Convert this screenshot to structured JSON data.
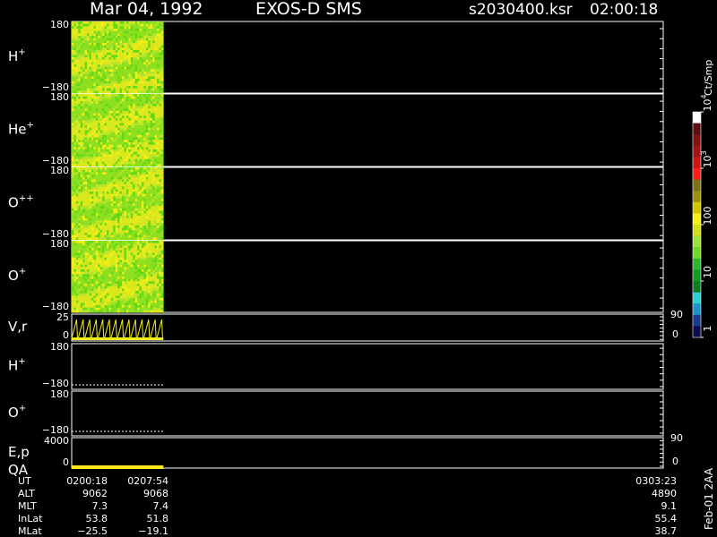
{
  "header": {
    "date": "Mar 04, 1992",
    "instrument": "EXOS-D SMS",
    "file_name": "s2030400.ksr",
    "time": "02:00:18"
  },
  "chart_data": {
    "type": "heatmap",
    "colorbar": {
      "label": "Ct/Smp",
      "ticks": [
        "1",
        "10",
        "100",
        "10",
        "10"
      ],
      "tick_exponents": [
        "",
        "",
        "",
        "3",
        "4"
      ],
      "min": 1,
      "max": 10000,
      "scale": "log",
      "colors": [
        "#0b0b52",
        "#163a8c",
        "#1f93c8",
        "#2bd0cf",
        "#0d7d24",
        "#129d22",
        "#2eb62d",
        "#71d92b",
        "#9be33a",
        "#d3dd16",
        "#f2ef17",
        "#d1c500",
        "#9c900f",
        "#7b7115",
        "#ff1d18",
        "#ce1515",
        "#a31414",
        "#821111",
        "#5d0f0f",
        "#ffffff"
      ]
    },
    "panels": [
      {
        "id": "h_plus_pitch",
        "label": "H",
        "label_superscript": "+",
        "kind": "spectrogram",
        "ylim": [
          -180,
          180
        ],
        "y_ticks": [
          "180",
          "−180"
        ],
        "data_fill": 0.155
      },
      {
        "id": "he_plus_pitch",
        "label": "He",
        "label_superscript": "+",
        "kind": "spectrogram",
        "ylim": [
          -180,
          180
        ],
        "y_ticks": [
          "180",
          "−180"
        ],
        "data_fill": 0.155
      },
      {
        "id": "o_plus_plus_pitch",
        "label": "O",
        "label_superscript": "++",
        "kind": "spectrogram",
        "ylim": [
          -180,
          180
        ],
        "y_ticks": [
          "180",
          "−180"
        ],
        "data_fill": 0.155
      },
      {
        "id": "o_plus_pitch",
        "label": "O",
        "label_superscript": "+",
        "kind": "spectrogram",
        "ylim": [
          -180,
          180
        ],
        "y_ticks": [
          "180",
          "−180"
        ],
        "data_fill": 0.155
      },
      {
        "id": "velocity_r",
        "label": "V,r",
        "label_superscript": "",
        "kind": "line",
        "left_ylim": [
          0,
          25
        ],
        "right_ylim": [
          0,
          90
        ],
        "y_ticks": [
          "25",
          "0"
        ],
        "right_ticks": [
          "90",
          "0"
        ],
        "data_fill": 0.155
      },
      {
        "id": "h_plus_line",
        "label": "H",
        "label_superscript": "+",
        "kind": "trace",
        "ylim": [
          -180,
          180
        ],
        "y_ticks": [
          "180",
          "−180"
        ],
        "data_fill": 0.155
      },
      {
        "id": "o_plus_line",
        "label": "O",
        "label_superscript": "+",
        "kind": "trace",
        "ylim": [
          -180,
          180
        ],
        "y_ticks": [
          "180",
          "−180"
        ],
        "data_fill": 0.155
      },
      {
        "id": "ep_qa",
        "label": "E,p",
        "label2": "QA",
        "label_superscript": "",
        "kind": "qa",
        "left_ylim": [
          0,
          4000
        ],
        "right_ylim": [
          0,
          90
        ],
        "y_ticks": [
          "4000",
          "0"
        ],
        "right_ticks": [
          "90",
          "0"
        ],
        "data_fill": 0.155
      }
    ],
    "time_axis": {
      "labels": [
        "0200:18",
        "0207:54",
        "0303:23"
      ]
    },
    "orbit_table": {
      "rows": [
        {
          "label": "UT",
          "values": [
            "0200:18",
            "0207:54",
            "0303:23"
          ]
        },
        {
          "label": "ALT",
          "values": [
            "9062",
            "9068",
            "4890"
          ]
        },
        {
          "label": "MLT",
          "values": [
            "7.3",
            "7.4",
            "9.1"
          ]
        },
        {
          "label": "InLat",
          "values": [
            "53.8",
            "51.8",
            "55.4"
          ]
        },
        {
          "label": "MLat",
          "values": [
            "−25.5",
            "−19.1",
            "38.7"
          ]
        }
      ]
    },
    "version_label": "Feb-01 2AA"
  }
}
